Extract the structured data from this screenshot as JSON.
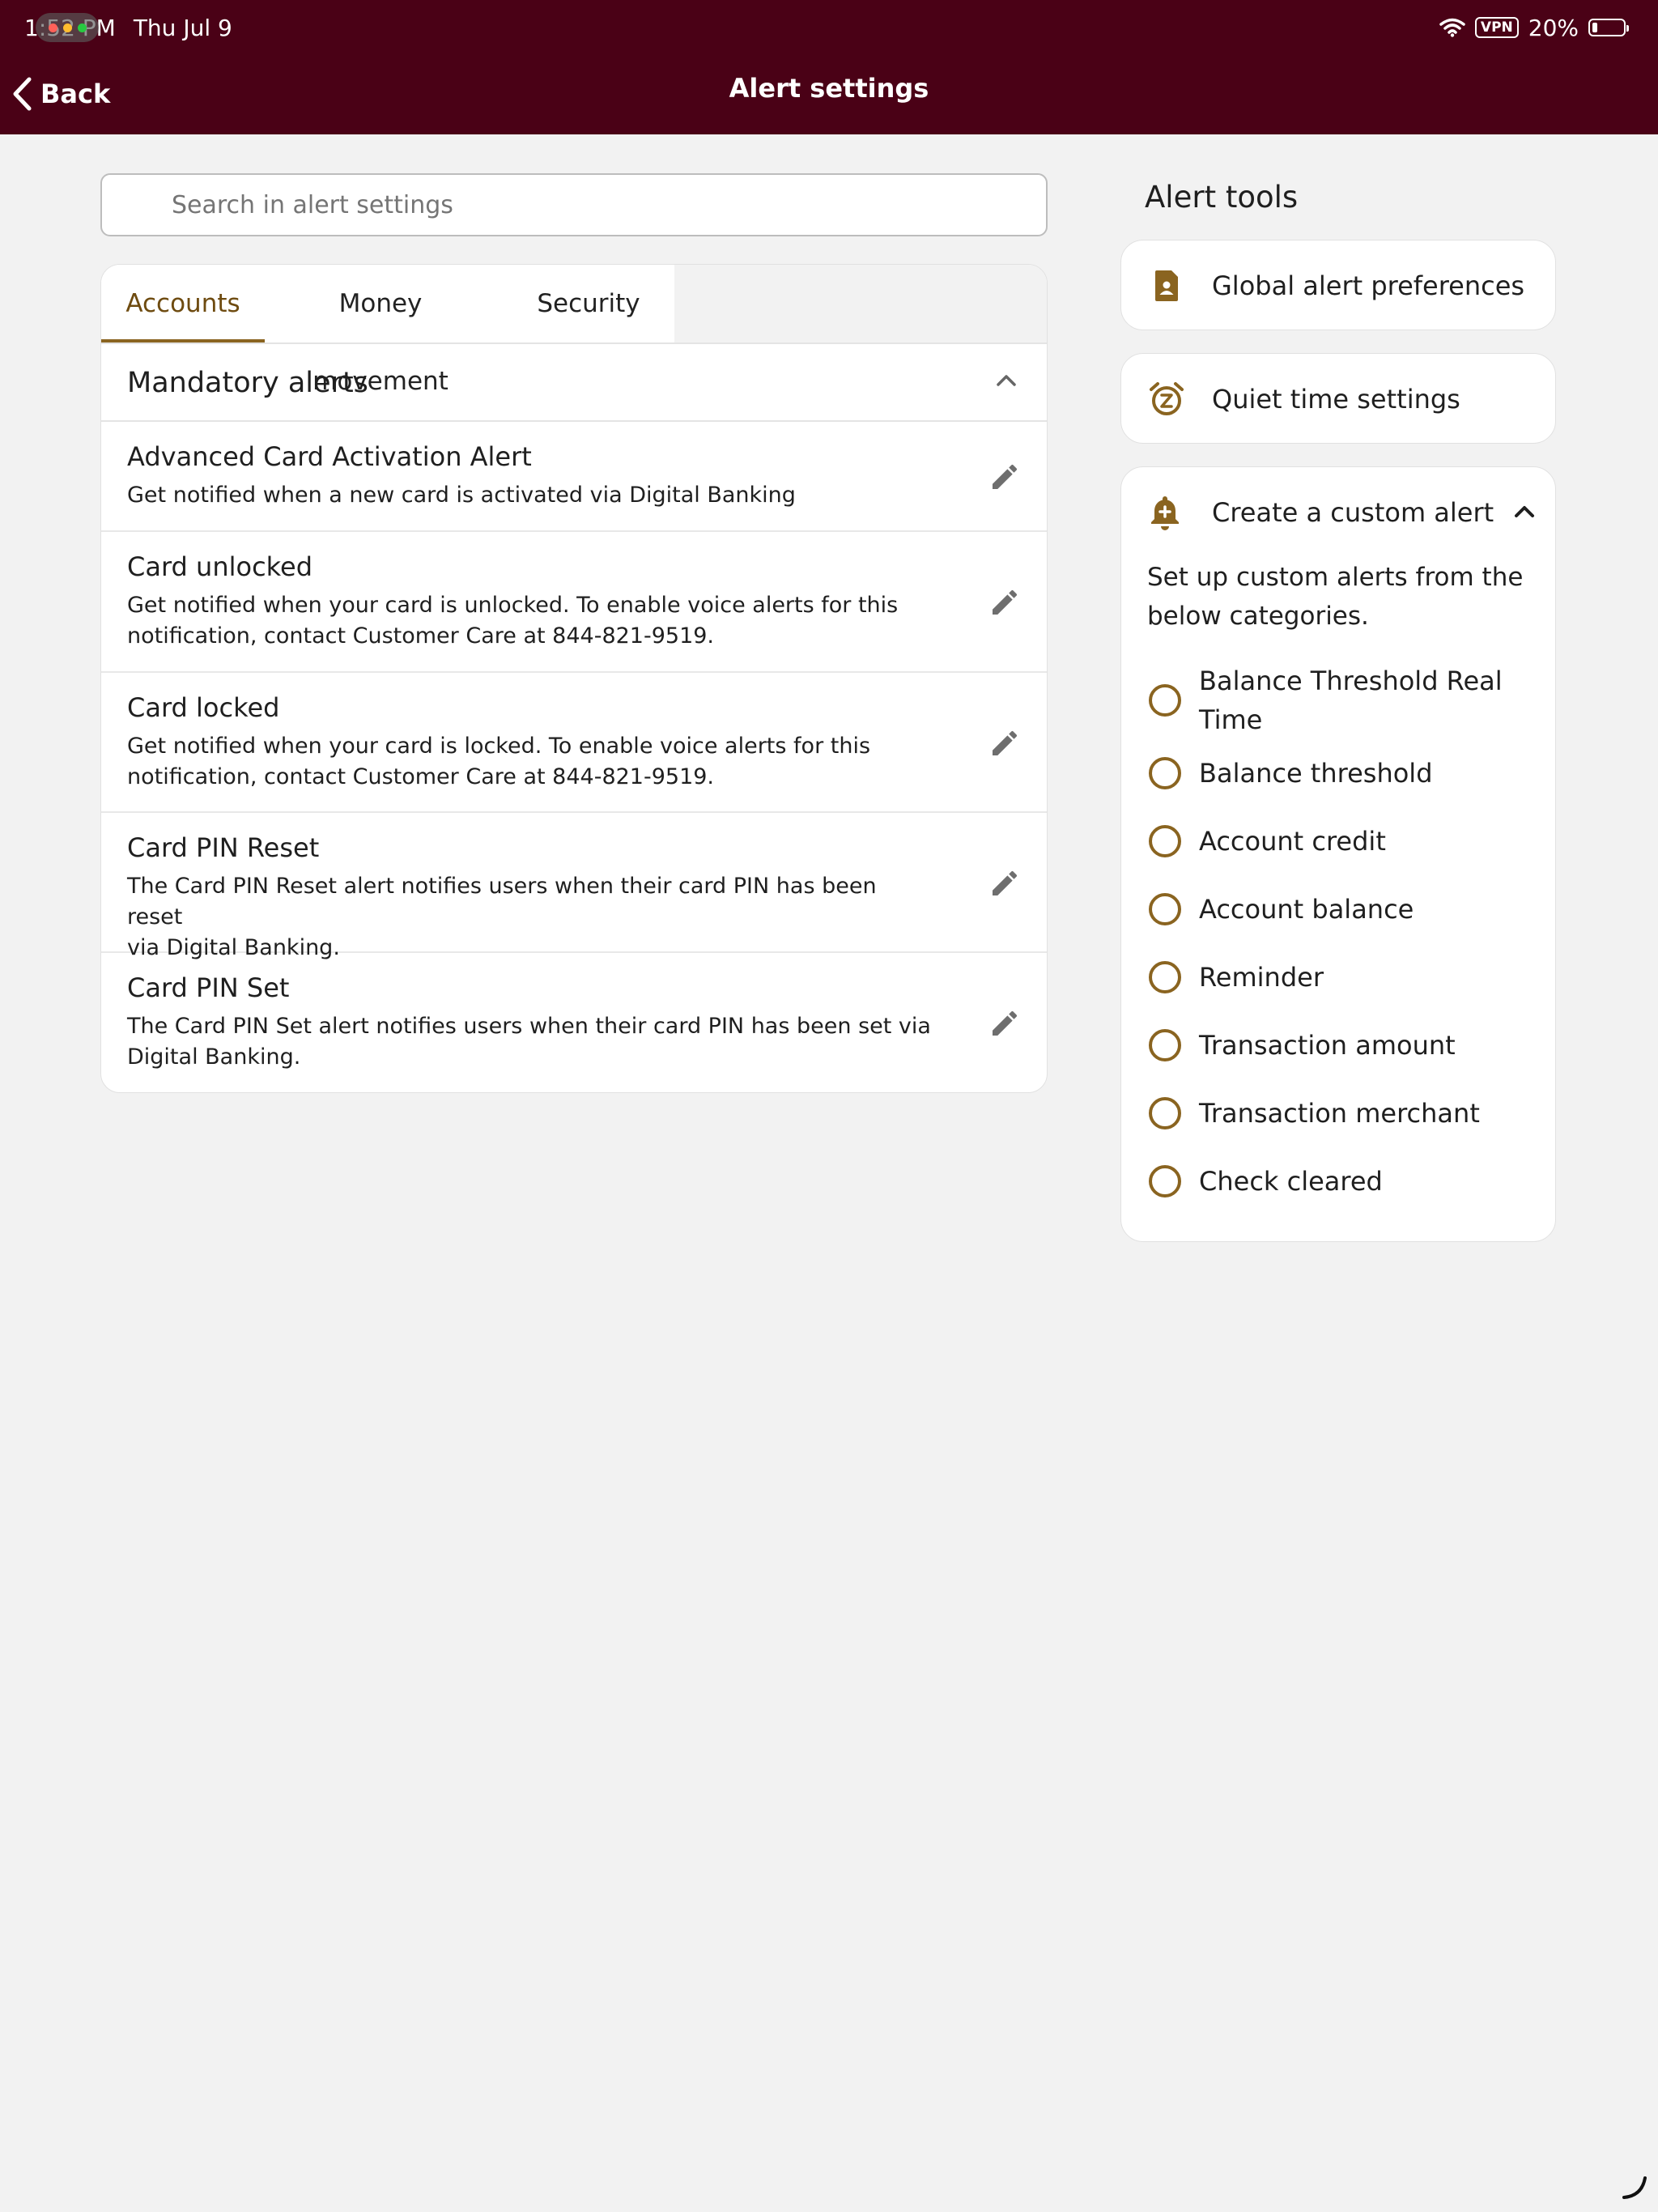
{
  "status_bar": {
    "time": "1:52 PM",
    "date": "Thu Jul 9",
    "vpn": "VPN",
    "battery": "20%",
    "wifi_icon": "wifi-icon",
    "battery_level": 0.2
  },
  "header": {
    "back_label": "Back",
    "title": "Alert settings"
  },
  "search": {
    "placeholder": "Search in alert settings"
  },
  "tabs": [
    {
      "label": "Accounts",
      "active": true
    },
    {
      "label": "Money movement",
      "active": false
    },
    {
      "label": "Security",
      "active": false
    }
  ],
  "section": {
    "title": "Mandatory alerts",
    "expanded": true
  },
  "alerts": [
    {
      "title": "Advanced Card Activation Alert",
      "desc_lines": [
        "Get notified when a new card is activated via Digital Banking"
      ]
    },
    {
      "title": "Card unlocked",
      "desc_lines": [
        "Get notified when your card is unlocked. To enable voice alerts for this",
        "notification, contact Customer Care at 844-821-9519."
      ]
    },
    {
      "title": "Card locked",
      "desc_lines": [
        "Get notified when your card is locked. To enable voice alerts for this",
        "notification, contact Customer Care at 844-821-9519."
      ]
    },
    {
      "title": "Card PIN Reset",
      "desc_lines": [
        "The Card PIN Reset alert notifies users when their card PIN has been reset",
        "via Digital Banking."
      ]
    },
    {
      "title": "Card PIN Set",
      "desc_lines": [
        "The Card PIN Set alert notifies users when their card PIN has been set via",
        "Digital Banking."
      ]
    }
  ],
  "alert_tools": {
    "title": "Alert tools",
    "global_label": "Global alert preferences",
    "quiet_label": "Quiet time settings",
    "custom": {
      "label": "Create a custom alert",
      "intro_lines": [
        "Set up custom alerts from the",
        "below categories."
      ],
      "options": [
        [
          "Balance Threshold Real",
          "Time"
        ],
        [
          "Balance threshold"
        ],
        [
          "Account credit"
        ],
        [
          "Account balance"
        ],
        [
          "Reminder"
        ],
        [
          "Transaction amount"
        ],
        [
          "Transaction merchant"
        ],
        [
          "Check cleared"
        ]
      ]
    }
  },
  "colors": {
    "header_bg": "#4a0116",
    "accent": "#8a6420",
    "page_bg": "#f2f2f2"
  }
}
